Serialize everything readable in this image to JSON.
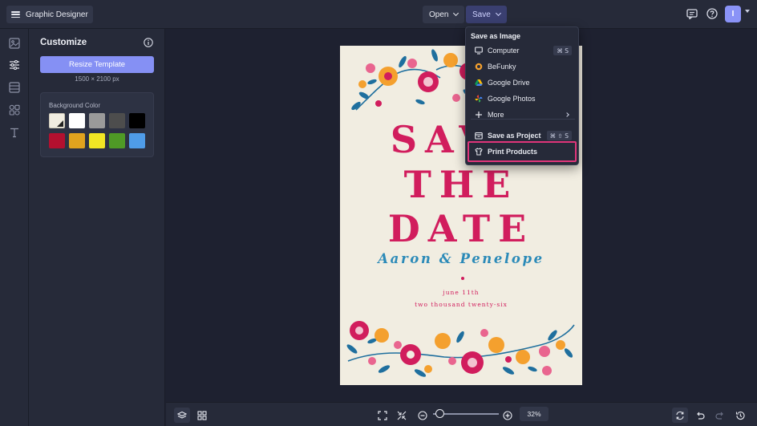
{
  "header": {
    "app_title": "Graphic Designer",
    "open_label": "Open",
    "save_label": "Save",
    "avatar_initial": "I"
  },
  "sidebar_rail": {
    "items": [
      "image-icon",
      "sliders-icon",
      "layout-icon",
      "graphics-icon",
      "text-icon"
    ],
    "active": "sliders-icon"
  },
  "panel": {
    "title": "Customize",
    "resize_button": "Resize Template",
    "dimensions": "1500 × 2100 px",
    "background": {
      "label": "Background Color",
      "swatches": [
        "#f1ede1",
        "#ffffff",
        "#9a9a9a",
        "#4d4d4d",
        "#000000",
        "#b3102f",
        "#e0a31e",
        "#f2e624",
        "#4f9a26",
        "#4f9ce8"
      ]
    }
  },
  "artboard": {
    "line1": "SAVE",
    "line2": "THE",
    "line3": "DATE",
    "names": "Aaron & Penelope",
    "date": "june 11th",
    "year": "two thousand twenty-six",
    "colors": {
      "paper": "#f1ede1",
      "magenta": "#d11d5d",
      "blue": "#2b8ab8",
      "orange": "#f4a02e",
      "teal": "#1f6f9e"
    }
  },
  "save_menu": {
    "heading": "Save as Image",
    "items": [
      {
        "label": "Computer",
        "shortcut": "⌘ S",
        "icon": "monitor-icon"
      },
      {
        "label": "BeFunky",
        "icon": "befunky-logo-icon"
      },
      {
        "label": "Google Drive",
        "icon": "google-drive-icon"
      },
      {
        "label": "Google Photos",
        "icon": "google-photos-icon"
      },
      {
        "label": "More",
        "icon": "plus-icon"
      }
    ],
    "project": {
      "label": "Save as Project",
      "shortcut": "⌘ ⇧ S",
      "icon": "project-save-icon"
    },
    "print": {
      "label": "Print Products",
      "icon": "shirt-icon"
    }
  },
  "bottom_bar": {
    "zoom": "32%",
    "zoom_level": 0.32
  }
}
